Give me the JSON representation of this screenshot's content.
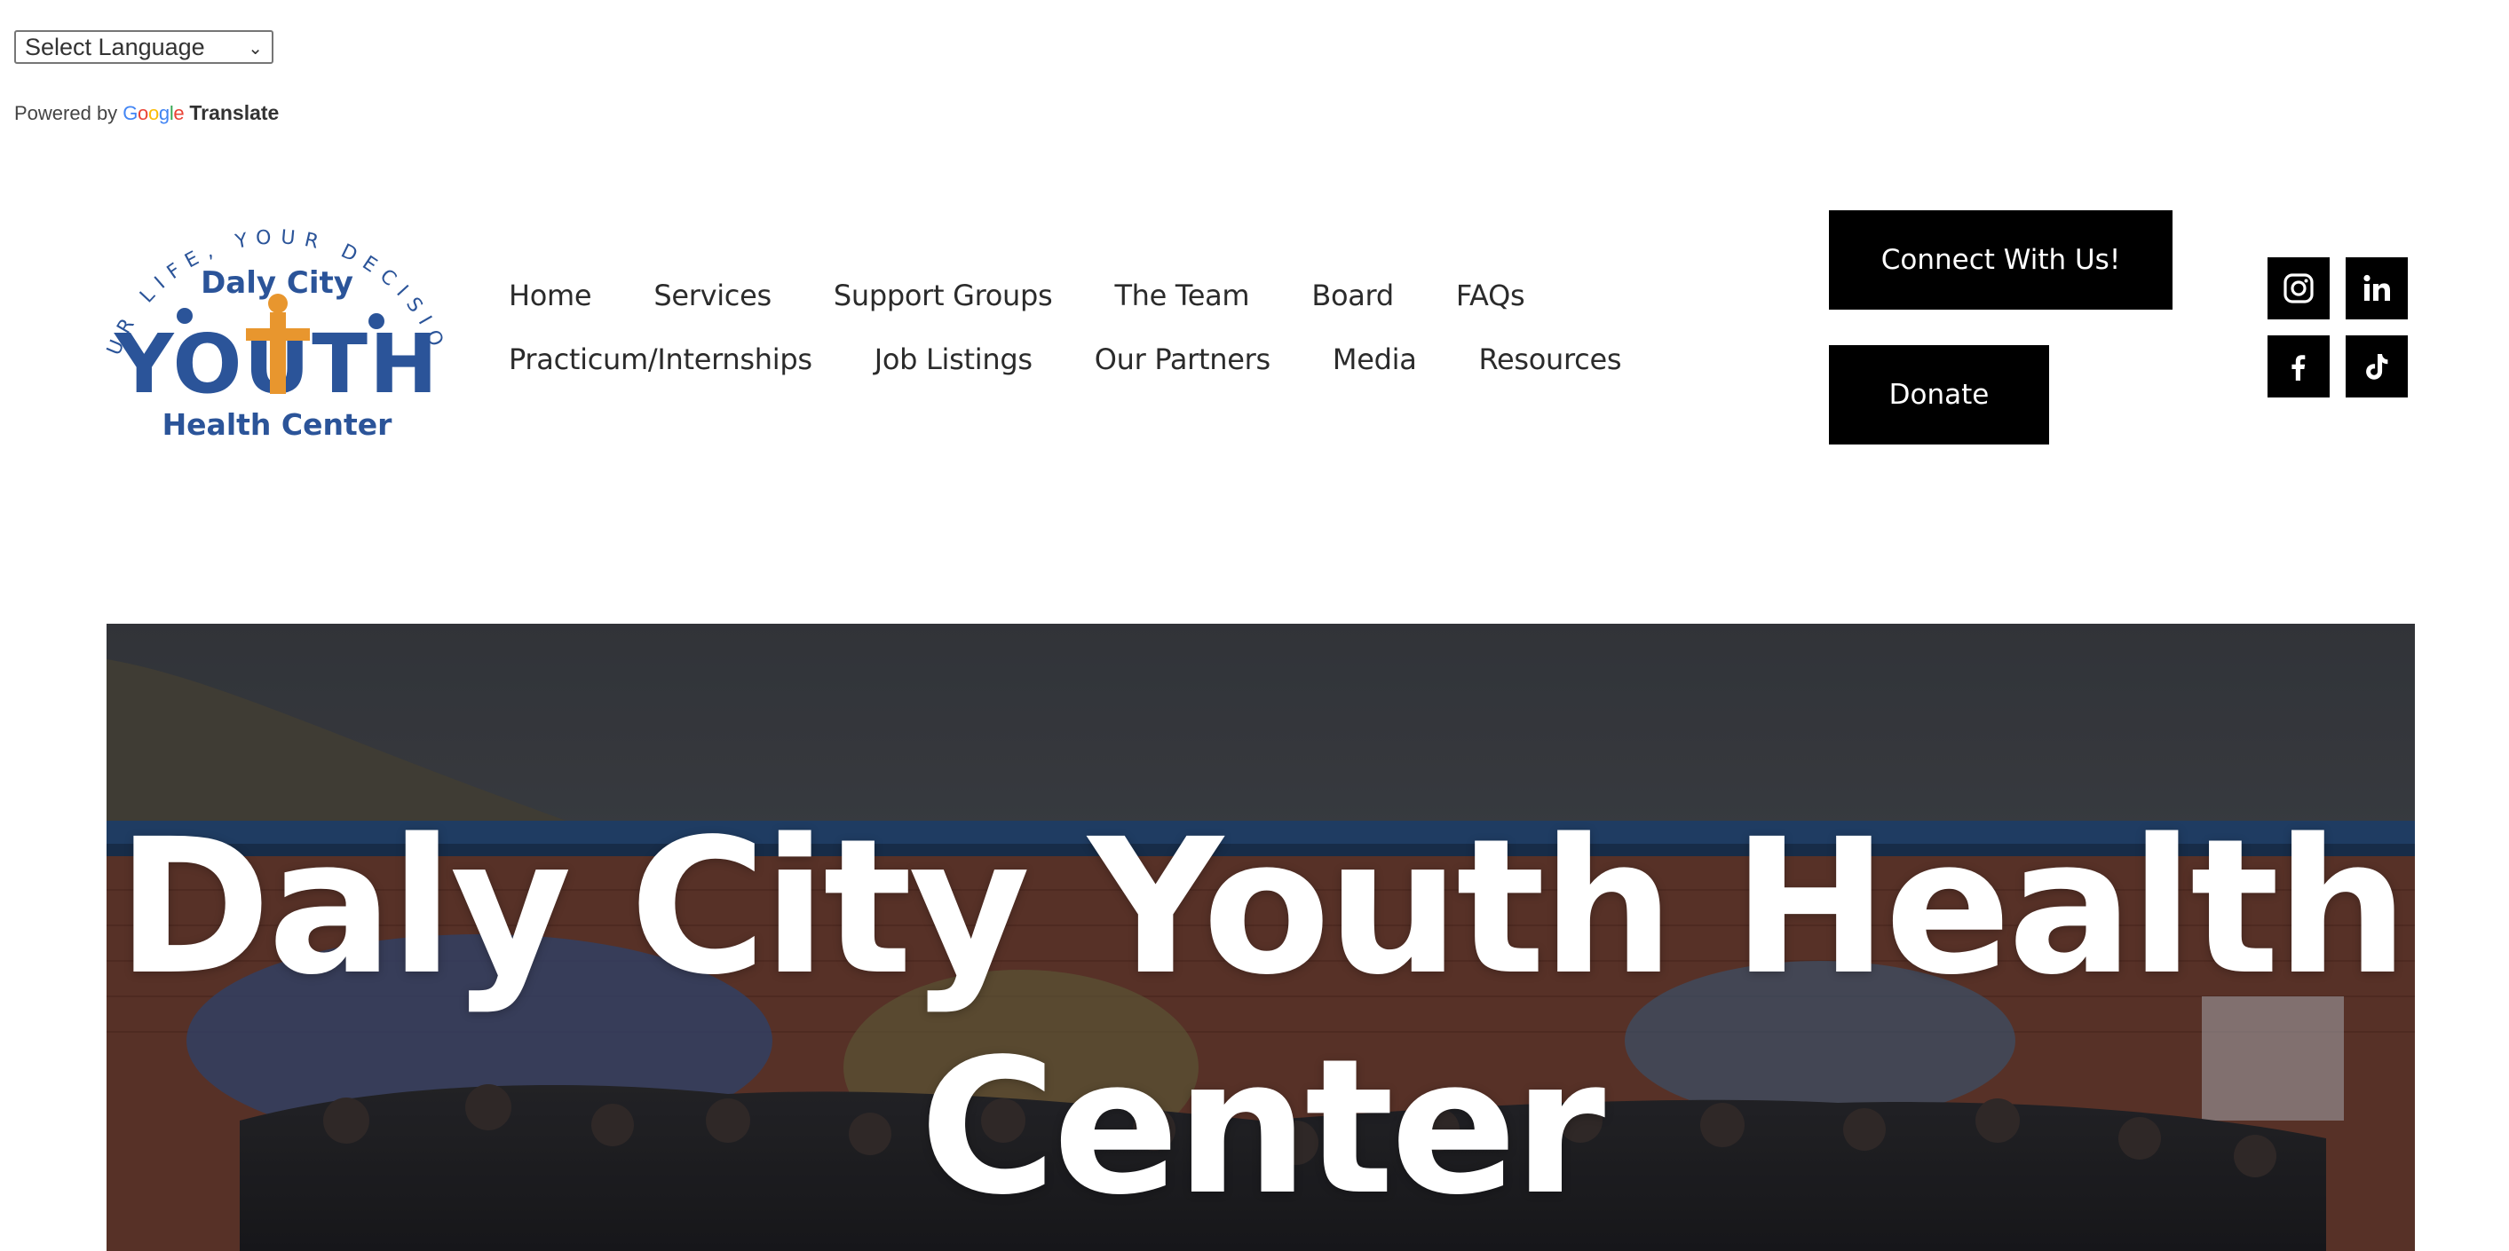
{
  "translate": {
    "select_label": "Select Language",
    "powered_by": "Powered by",
    "google": [
      "G",
      "o",
      "o",
      "g",
      "l",
      "e"
    ],
    "translate": "Translate"
  },
  "logo": {
    "arc_text": "YOUR LIFE, YOUR DECISIONS",
    "line1": "Daly City",
    "line2": "YOUTH",
    "line3": "Health Center"
  },
  "nav": {
    "row1": [
      "Home",
      "Services",
      "Support Groups",
      "The Team",
      "Board",
      "FAQs"
    ],
    "row2": [
      "Practicum/Internships",
      "Job Listings",
      "Our Partners",
      "Media",
      "Resources"
    ]
  },
  "buttons": {
    "connect": "Connect With Us!",
    "donate": "Donate"
  },
  "social": [
    "instagram-icon",
    "linkedin-icon",
    "facebook-icon",
    "tiktok-icon"
  ],
  "hero": {
    "title": "Daly City Youth Health Center"
  },
  "colors": {
    "logo_blue": "#2b5499",
    "logo_orange": "#e8962e",
    "button_bg": "#000000",
    "google_blue": "#4285F4",
    "google_red": "#EA4335",
    "google_yellow": "#FBBC05",
    "google_green": "#34A853"
  }
}
